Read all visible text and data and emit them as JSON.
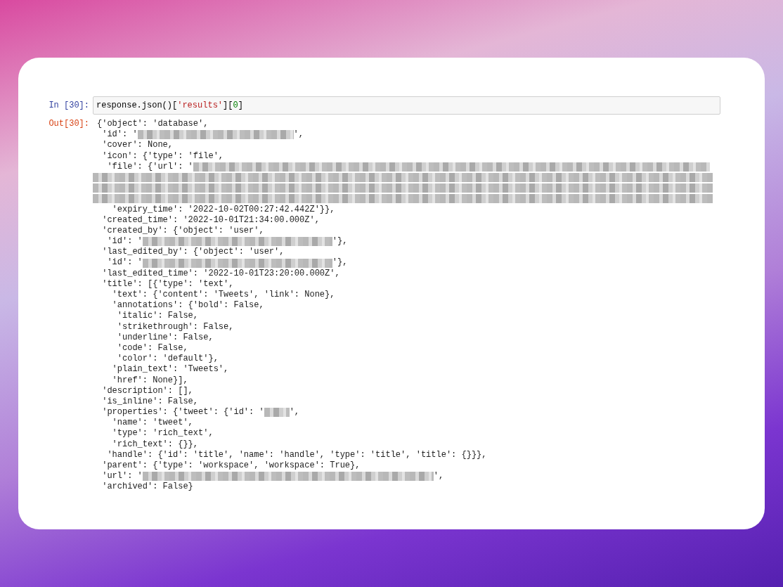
{
  "input_cell": {
    "prompt": "In [30]:",
    "code": [
      {
        "kind": "plain",
        "text": "response.json()["
      },
      {
        "kind": "string",
        "text": "'results'"
      },
      {
        "kind": "plain",
        "text": "]["
      },
      {
        "kind": "number",
        "text": "0"
      },
      {
        "kind": "plain",
        "text": "]"
      }
    ]
  },
  "output_cell": {
    "prompt": "Out[30]:",
    "lines": [
      [
        {
          "kind": "text",
          "text": "{'object': 'database',"
        }
      ],
      [
        {
          "kind": "text",
          "text": " 'id': '"
        },
        {
          "kind": "redacted_medium"
        },
        {
          "kind": "text",
          "text": "',"
        }
      ],
      [
        {
          "kind": "text",
          "text": " 'cover': None,"
        }
      ],
      [
        {
          "kind": "text",
          "text": " 'icon': {'type': 'file',"
        }
      ],
      [
        {
          "kind": "text",
          "text": "  'file': {'url': '"
        },
        {
          "kind": "redacted_rest"
        }
      ],
      [
        {
          "kind": "redacted_line"
        }
      ],
      [
        {
          "kind": "redacted_line"
        }
      ],
      [
        {
          "kind": "redacted_line"
        }
      ],
      [
        {
          "kind": "text",
          "text": "   'expiry_time': '2022-10-02T00:27:42.442Z'}},"
        }
      ],
      [
        {
          "kind": "text",
          "text": " 'created_time': '2022-10-01T21:34:00.000Z',"
        }
      ],
      [
        {
          "kind": "text",
          "text": " 'created_by': {'object': 'user',"
        }
      ],
      [
        {
          "kind": "text",
          "text": "  'id': '"
        },
        {
          "kind": "redacted_long"
        },
        {
          "kind": "text",
          "text": "'},"
        }
      ],
      [
        {
          "kind": "text",
          "text": " 'last_edited_by': {'object': 'user',"
        }
      ],
      [
        {
          "kind": "text",
          "text": "  'id': '"
        },
        {
          "kind": "redacted_long"
        },
        {
          "kind": "text",
          "text": "'},"
        }
      ],
      [
        {
          "kind": "text",
          "text": " 'last_edited_time': '2022-10-01T23:20:00.000Z',"
        }
      ],
      [
        {
          "kind": "text",
          "text": " 'title': [{'type': 'text',"
        }
      ],
      [
        {
          "kind": "text",
          "text": "   'text': {'content': 'Tweets', 'link': None},"
        }
      ],
      [
        {
          "kind": "text",
          "text": "   'annotations': {'bold': False,"
        }
      ],
      [
        {
          "kind": "text",
          "text": "    'italic': False,"
        }
      ],
      [
        {
          "kind": "text",
          "text": "    'strikethrough': False,"
        }
      ],
      [
        {
          "kind": "text",
          "text": "    'underline': False,"
        }
      ],
      [
        {
          "kind": "text",
          "text": "    'code': False,"
        }
      ],
      [
        {
          "kind": "text",
          "text": "    'color': 'default'},"
        }
      ],
      [
        {
          "kind": "text",
          "text": "   'plain_text': 'Tweets',"
        }
      ],
      [
        {
          "kind": "text",
          "text": "   'href': None}],"
        }
      ],
      [
        {
          "kind": "text",
          "text": " 'description': [],"
        }
      ],
      [
        {
          "kind": "text",
          "text": " 'is_inline': False,"
        }
      ],
      [
        {
          "kind": "text",
          "text": " 'properties': {'tweet': {'id': '"
        },
        {
          "kind": "redacted_short"
        },
        {
          "kind": "text",
          "text": "',"
        }
      ],
      [
        {
          "kind": "text",
          "text": "   'name': 'tweet',"
        }
      ],
      [
        {
          "kind": "text",
          "text": "   'type': 'rich_text',"
        }
      ],
      [
        {
          "kind": "text",
          "text": "   'rich_text': {}},"
        }
      ],
      [
        {
          "kind": "text",
          "text": "  'handle': {'id': 'title', 'name': 'handle', 'type': 'title', 'title': {}}},"
        }
      ],
      [
        {
          "kind": "text",
          "text": " 'parent': {'type': 'workspace', 'workspace': True},"
        }
      ],
      [
        {
          "kind": "text",
          "text": " 'url': '"
        },
        {
          "kind": "redacted_xlong"
        },
        {
          "kind": "text",
          "text": "',"
        }
      ],
      [
        {
          "kind": "text",
          "text": " 'archived': False}"
        }
      ]
    ]
  }
}
